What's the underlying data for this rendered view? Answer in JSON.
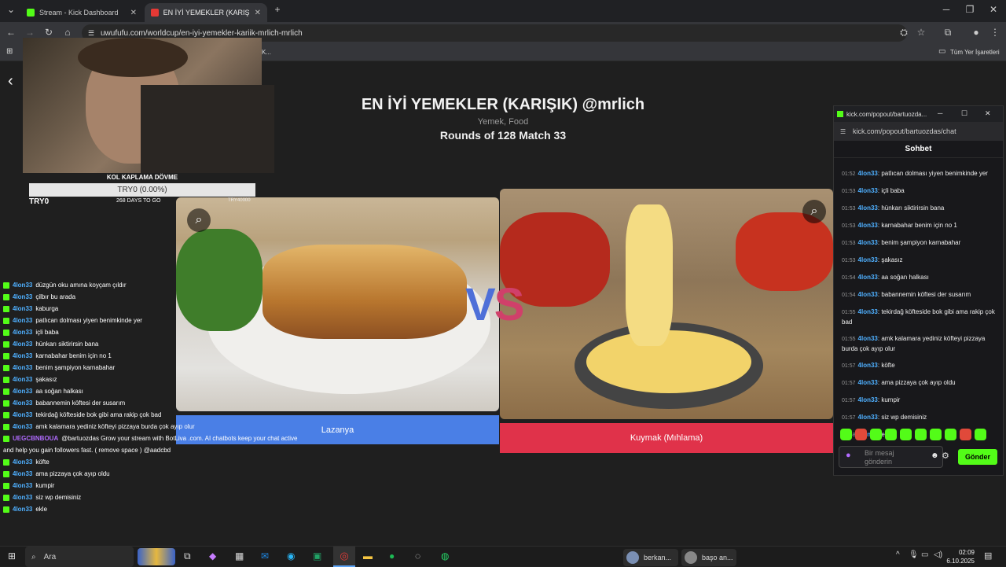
{
  "browser": {
    "tabs": [
      {
        "title": "Stream - Kick Dashboard",
        "color": "#53fc18"
      },
      {
        "title": "EN İYİ YEMEKLER (KARIŞIK) @m",
        "color": "#e53935"
      }
    ],
    "url": "uwufufu.com/worldcup/en-iyi-yemekler-kariik-mrlich-mrlich",
    "bookmarks_folder": "Tüm Yer İşaretleri",
    "bookmark_partial": "K..."
  },
  "page": {
    "title": "EN İYİ YEMEKLER (KARIŞIK) @mrlich",
    "subtitle": "Yemek, Food",
    "rounds": "Rounds of 128 Match 33",
    "left_option": "Lazanya",
    "right_option": "Kuymak (Mıhlama)",
    "vs_v": "V",
    "vs_s": "S"
  },
  "stream_overlay": {
    "goal_title": "KOL KAPLAMA DÖVME",
    "goal_bar_text": "TRY0 (0.00%)",
    "goal_progress": 0.0,
    "goal_current": "TRY0",
    "goal_days": "268 DAYS TO GO",
    "goal_target": "TRY40000",
    "chat": [
      {
        "user": "4lon33",
        "text": "düzgün oku amına koyçam çıldır"
      },
      {
        "user": "4lon33",
        "text": "çilbır bu arada"
      },
      {
        "user": "4lon33",
        "text": "kaburga"
      },
      {
        "user": "4lon33",
        "text": "patlıcan dolması yiyen benimkinde yer"
      },
      {
        "user": "4lon33",
        "text": "içli baba"
      },
      {
        "user": "4lon33",
        "text": "hünkarı siktirirsin bana"
      },
      {
        "user": "4lon33",
        "text": "karnabahar benim için no 1"
      },
      {
        "user": "4lon33",
        "text": "benim şampiyon karnabahar"
      },
      {
        "user": "4lon33",
        "text": "şakasız"
      },
      {
        "user": "4lon33",
        "text": "aa soğan halkası"
      },
      {
        "user": "4lon33",
        "text": "babannemin köftesi der susarım"
      },
      {
        "user": "4lon33",
        "text": "tekirdağ köfteside bok gibi ama rakip çok bad"
      },
      {
        "user": "4lon33",
        "text": "amk kalamara yediniz köfteyi pizzaya burda çok ayıp olur"
      },
      {
        "user": "UEGCBNBOUA",
        "text": "@bartuozdas Grow your stream with BotLiva .com. AI chatbots keep your chat active"
      },
      {
        "user": "",
        "text": "and help you gain followers fast. ( remove space ) @aadcbd"
      },
      {
        "user": "4lon33",
        "text": "köfte"
      },
      {
        "user": "4lon33",
        "text": "ama pizzaya çok ayıp oldu"
      },
      {
        "user": "4lon33",
        "text": "kumpir"
      },
      {
        "user": "4lon33",
        "text": "siz wp demisiniz"
      },
      {
        "user": "4lon33",
        "text": "ekle"
      }
    ]
  },
  "popout": {
    "window_title": "kick.com/popout/bartuozda...",
    "url": "kick.com/popout/bartuozdas/chat",
    "header": "Sohbet",
    "messages": [
      {
        "time": "01:52",
        "user": "4lon33",
        "text": "patlıcan dolması yiyen benimkinde yer"
      },
      {
        "time": "01:53",
        "user": "4lon33",
        "text": "içli baba"
      },
      {
        "time": "01:53",
        "user": "4lon33",
        "text": "hünkarı siktirirsin bana"
      },
      {
        "time": "01:53",
        "user": "4lon33",
        "text": "karnabahar benim için no 1"
      },
      {
        "time": "01:53",
        "user": "4lon33",
        "text": "benim şampiyon karnabahar"
      },
      {
        "time": "01:53",
        "user": "4lon33",
        "text": "şakasız"
      },
      {
        "time": "01:54",
        "user": "4lon33",
        "text": "aa soğan halkası"
      },
      {
        "time": "01:54",
        "user": "4lon33",
        "text": "babannemin köftesi der susarım"
      },
      {
        "time": "01:55",
        "user": "4lon33",
        "text": "tekirdağ köfteside bok gibi ama rakip çok bad"
      },
      {
        "time": "01:55",
        "user": "4lon33",
        "text": "amk kalamara yediniz köfteyi pizzaya burda çok ayıp olur"
      },
      {
        "time": "01:57",
        "user": "4lon33",
        "text": "köfte"
      },
      {
        "time": "01:57",
        "user": "4lon33",
        "text": "ama pizzaya çok ayıp oldu"
      },
      {
        "time": "01:57",
        "user": "4lon33",
        "text": "kumpir"
      },
      {
        "time": "01:57",
        "user": "4lon33",
        "text": "siz wp demisiniz"
      },
      {
        "time": "01:58",
        "user": "4lon33",
        "text": "ekle"
      }
    ],
    "input_placeholder": "Bir mesaj gönderin",
    "send_label": "Gönder"
  },
  "taskbar": {
    "search_placeholder": "Ara",
    "app1": "berkan...",
    "app2": "başo an...",
    "time": "02:09",
    "date": "6.10.2025"
  },
  "colors": {
    "kick_green": "#53fc18",
    "left_blue": "#4a7fe6",
    "right_red": "#e0324a"
  }
}
